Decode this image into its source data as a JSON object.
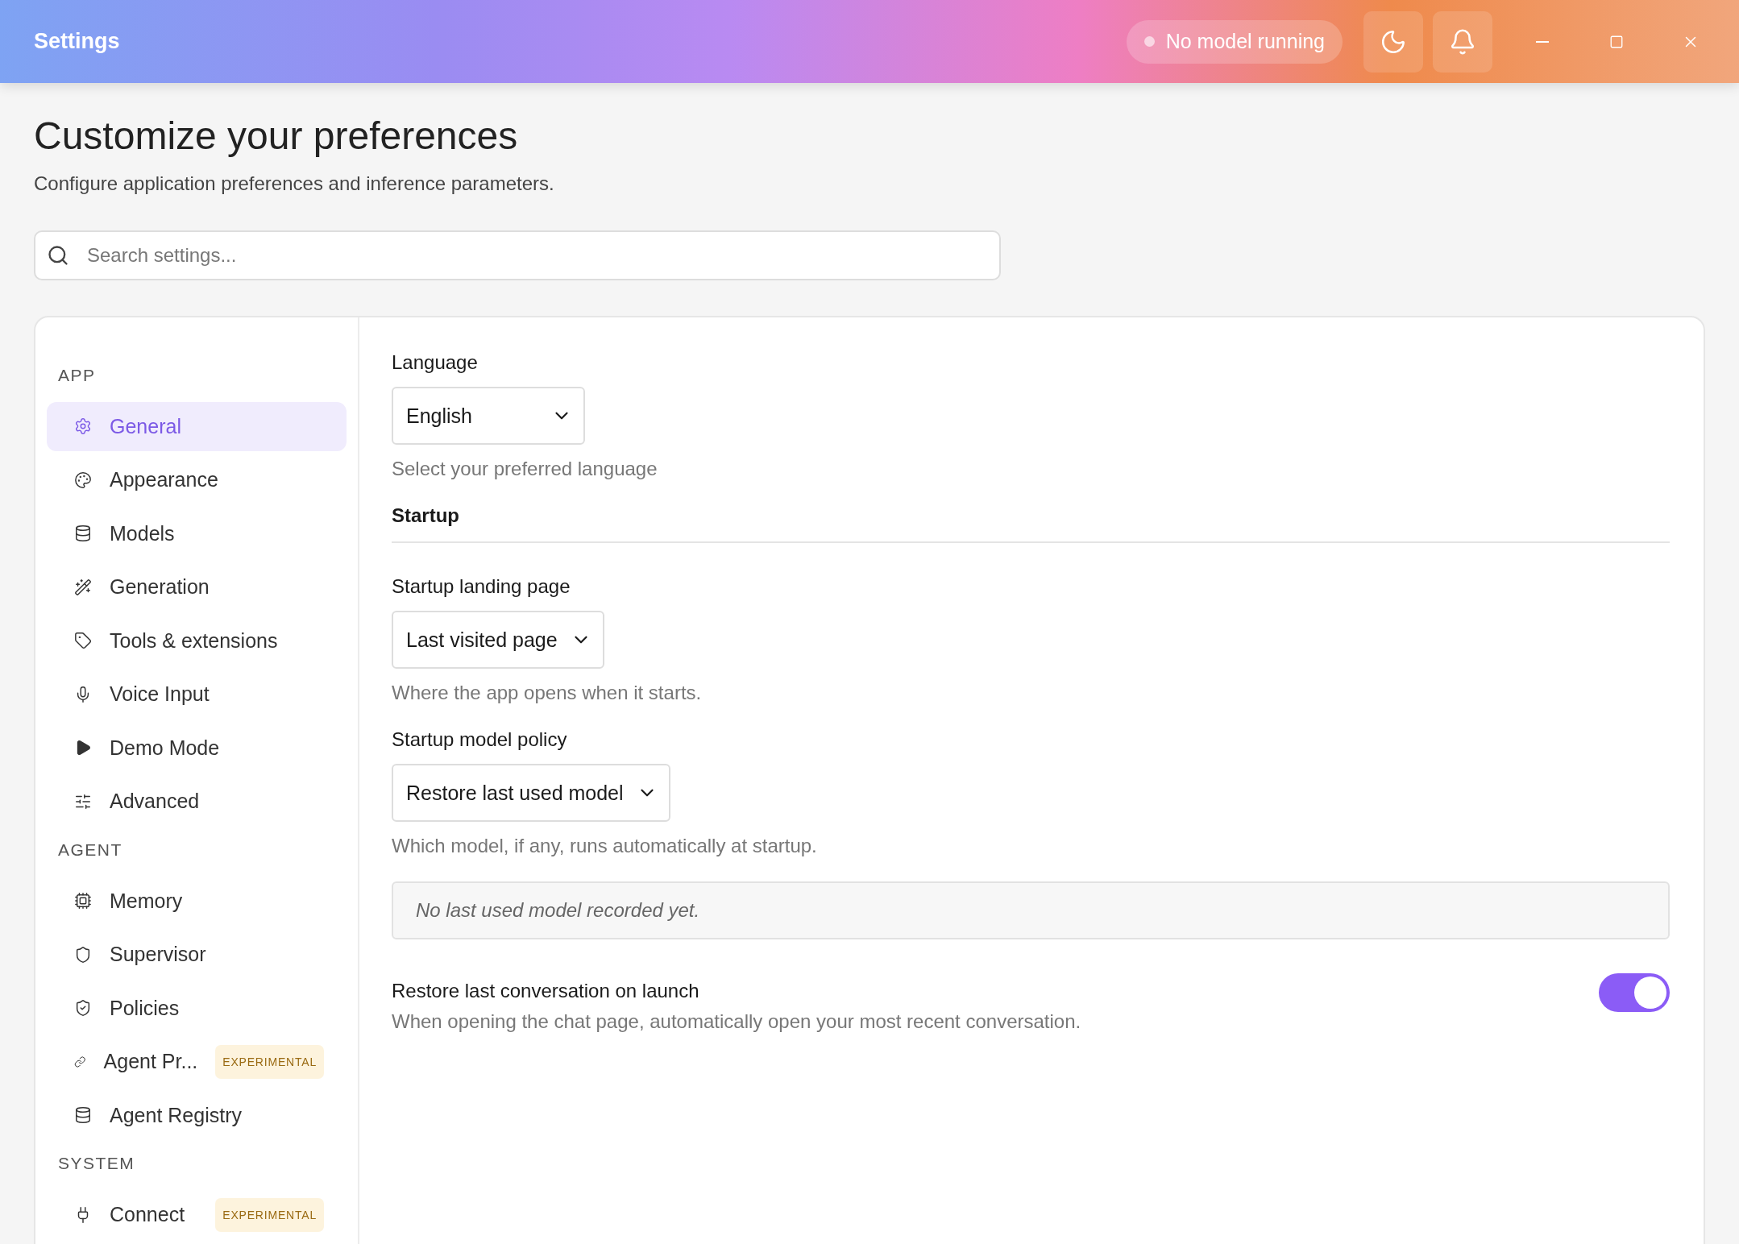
{
  "window": {
    "title": "Settings",
    "status": {
      "label": "No model running",
      "running": false
    }
  },
  "header": {
    "title": "Customize your preferences",
    "subtitle": "Configure application preferences and inference parameters."
  },
  "search": {
    "placeholder": "Search settings..."
  },
  "sidebar": {
    "sections": [
      {
        "label": "APP",
        "items": [
          {
            "label": "General",
            "selected": true
          },
          {
            "label": "Appearance",
            "selected": false
          },
          {
            "label": "Models",
            "selected": false
          },
          {
            "label": "Generation",
            "selected": false
          },
          {
            "label": "Tools & extensions",
            "selected": false
          },
          {
            "label": "Voice Input",
            "selected": false
          },
          {
            "label": "Demo Mode",
            "selected": false
          },
          {
            "label": "Advanced",
            "selected": false
          }
        ]
      },
      {
        "label": "AGENT",
        "items": [
          {
            "label": "Memory",
            "selected": false
          },
          {
            "label": "Supervisor",
            "selected": false
          },
          {
            "label": "Policies",
            "selected": false
          },
          {
            "label": "Agent Pr...",
            "selected": false,
            "badge": "EXPERIMENTAL"
          },
          {
            "label": "Agent Registry",
            "selected": false
          }
        ]
      },
      {
        "label": "SYSTEM",
        "items": [
          {
            "label": "Connect",
            "selected": false,
            "badge": "EXPERIMENTAL"
          }
        ]
      }
    ]
  },
  "settings": [
    {
      "kind": "select",
      "label": "Language",
      "value": "English",
      "hint": "Select your preferred language"
    },
    {
      "kind": "heading",
      "label": "Startup"
    },
    {
      "kind": "select",
      "label": "Startup landing page",
      "value": "Last visited page",
      "hint": "Where the app opens when it starts."
    },
    {
      "kind": "select",
      "label": "Startup model policy",
      "value": "Restore last used model",
      "hint": "Which model, if any, runs automatically at startup."
    },
    {
      "kind": "note",
      "text": "No last used model recorded yet."
    },
    {
      "kind": "toggle",
      "label": "Restore last conversation on launch",
      "hint": "When opening the chat page, automatically open your most recent conversation.",
      "on": true
    }
  ]
}
